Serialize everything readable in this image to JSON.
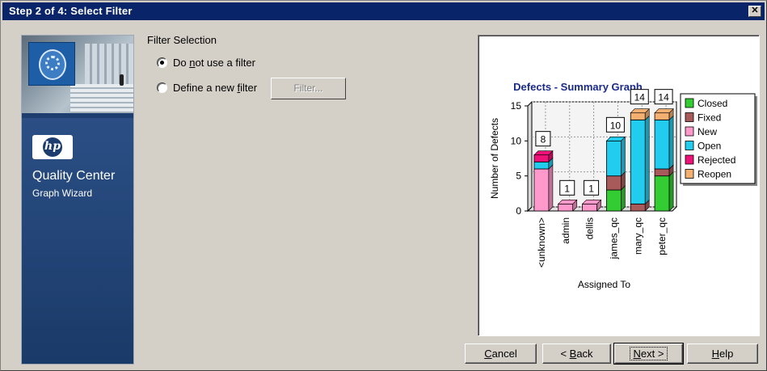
{
  "window": {
    "title": "Step 2 of 4: Select Filter",
    "close_glyph": "✕"
  },
  "sidebar": {
    "brand": "hp",
    "product": "Quality Center",
    "subtitle": "Graph Wizard"
  },
  "filter": {
    "heading": "Filter Selection",
    "option_no_filter": {
      "pre": "Do ",
      "accel": "n",
      "post": "ot use a filter",
      "checked": true
    },
    "option_new_filter": {
      "pre": "Define a new ",
      "accel": "f",
      "post": "ilter",
      "checked": false
    },
    "filter_button": "Filter..."
  },
  "chart_data": {
    "type": "bar",
    "stacked": true,
    "title": "Defects - Summary Graph",
    "xlabel": "Assigned To",
    "ylabel": "Number of Defects",
    "ylim": [
      0,
      15
    ],
    "yticks": [
      0,
      5,
      10,
      15
    ],
    "grid": true,
    "legend_position": "right",
    "categories": [
      "<unknown>",
      "admin",
      "dellis",
      "james_qc",
      "mary_qc",
      "peter_qc"
    ],
    "totals": [
      8,
      1,
      1,
      10,
      14,
      14
    ],
    "series": [
      {
        "name": "Closed",
        "color": "#33cc33",
        "values": [
          0,
          0,
          0,
          3,
          0,
          5
        ]
      },
      {
        "name": "Fixed",
        "color": "#a85a5a",
        "values": [
          0,
          0,
          0,
          2,
          1,
          1
        ]
      },
      {
        "name": "New",
        "color": "#ff99cc",
        "values": [
          6,
          1,
          1,
          0,
          0,
          0
        ]
      },
      {
        "name": "Open",
        "color": "#22ccee",
        "values": [
          1,
          0,
          0,
          5,
          12,
          7
        ]
      },
      {
        "name": "Rejected",
        "color": "#ee1177",
        "values": [
          1,
          0,
          0,
          0,
          0,
          0
        ]
      },
      {
        "name": "Reopen",
        "color": "#f4b070",
        "values": [
          0,
          0,
          0,
          0,
          1,
          1
        ]
      }
    ]
  },
  "buttons": {
    "cancel": {
      "accel": "C",
      "rest": "ancel"
    },
    "back": {
      "pre": "< ",
      "accel": "B",
      "rest": "ack"
    },
    "next": {
      "accel": "N",
      "rest": "ext >"
    },
    "help": {
      "accel": "H",
      "rest": "elp"
    }
  }
}
